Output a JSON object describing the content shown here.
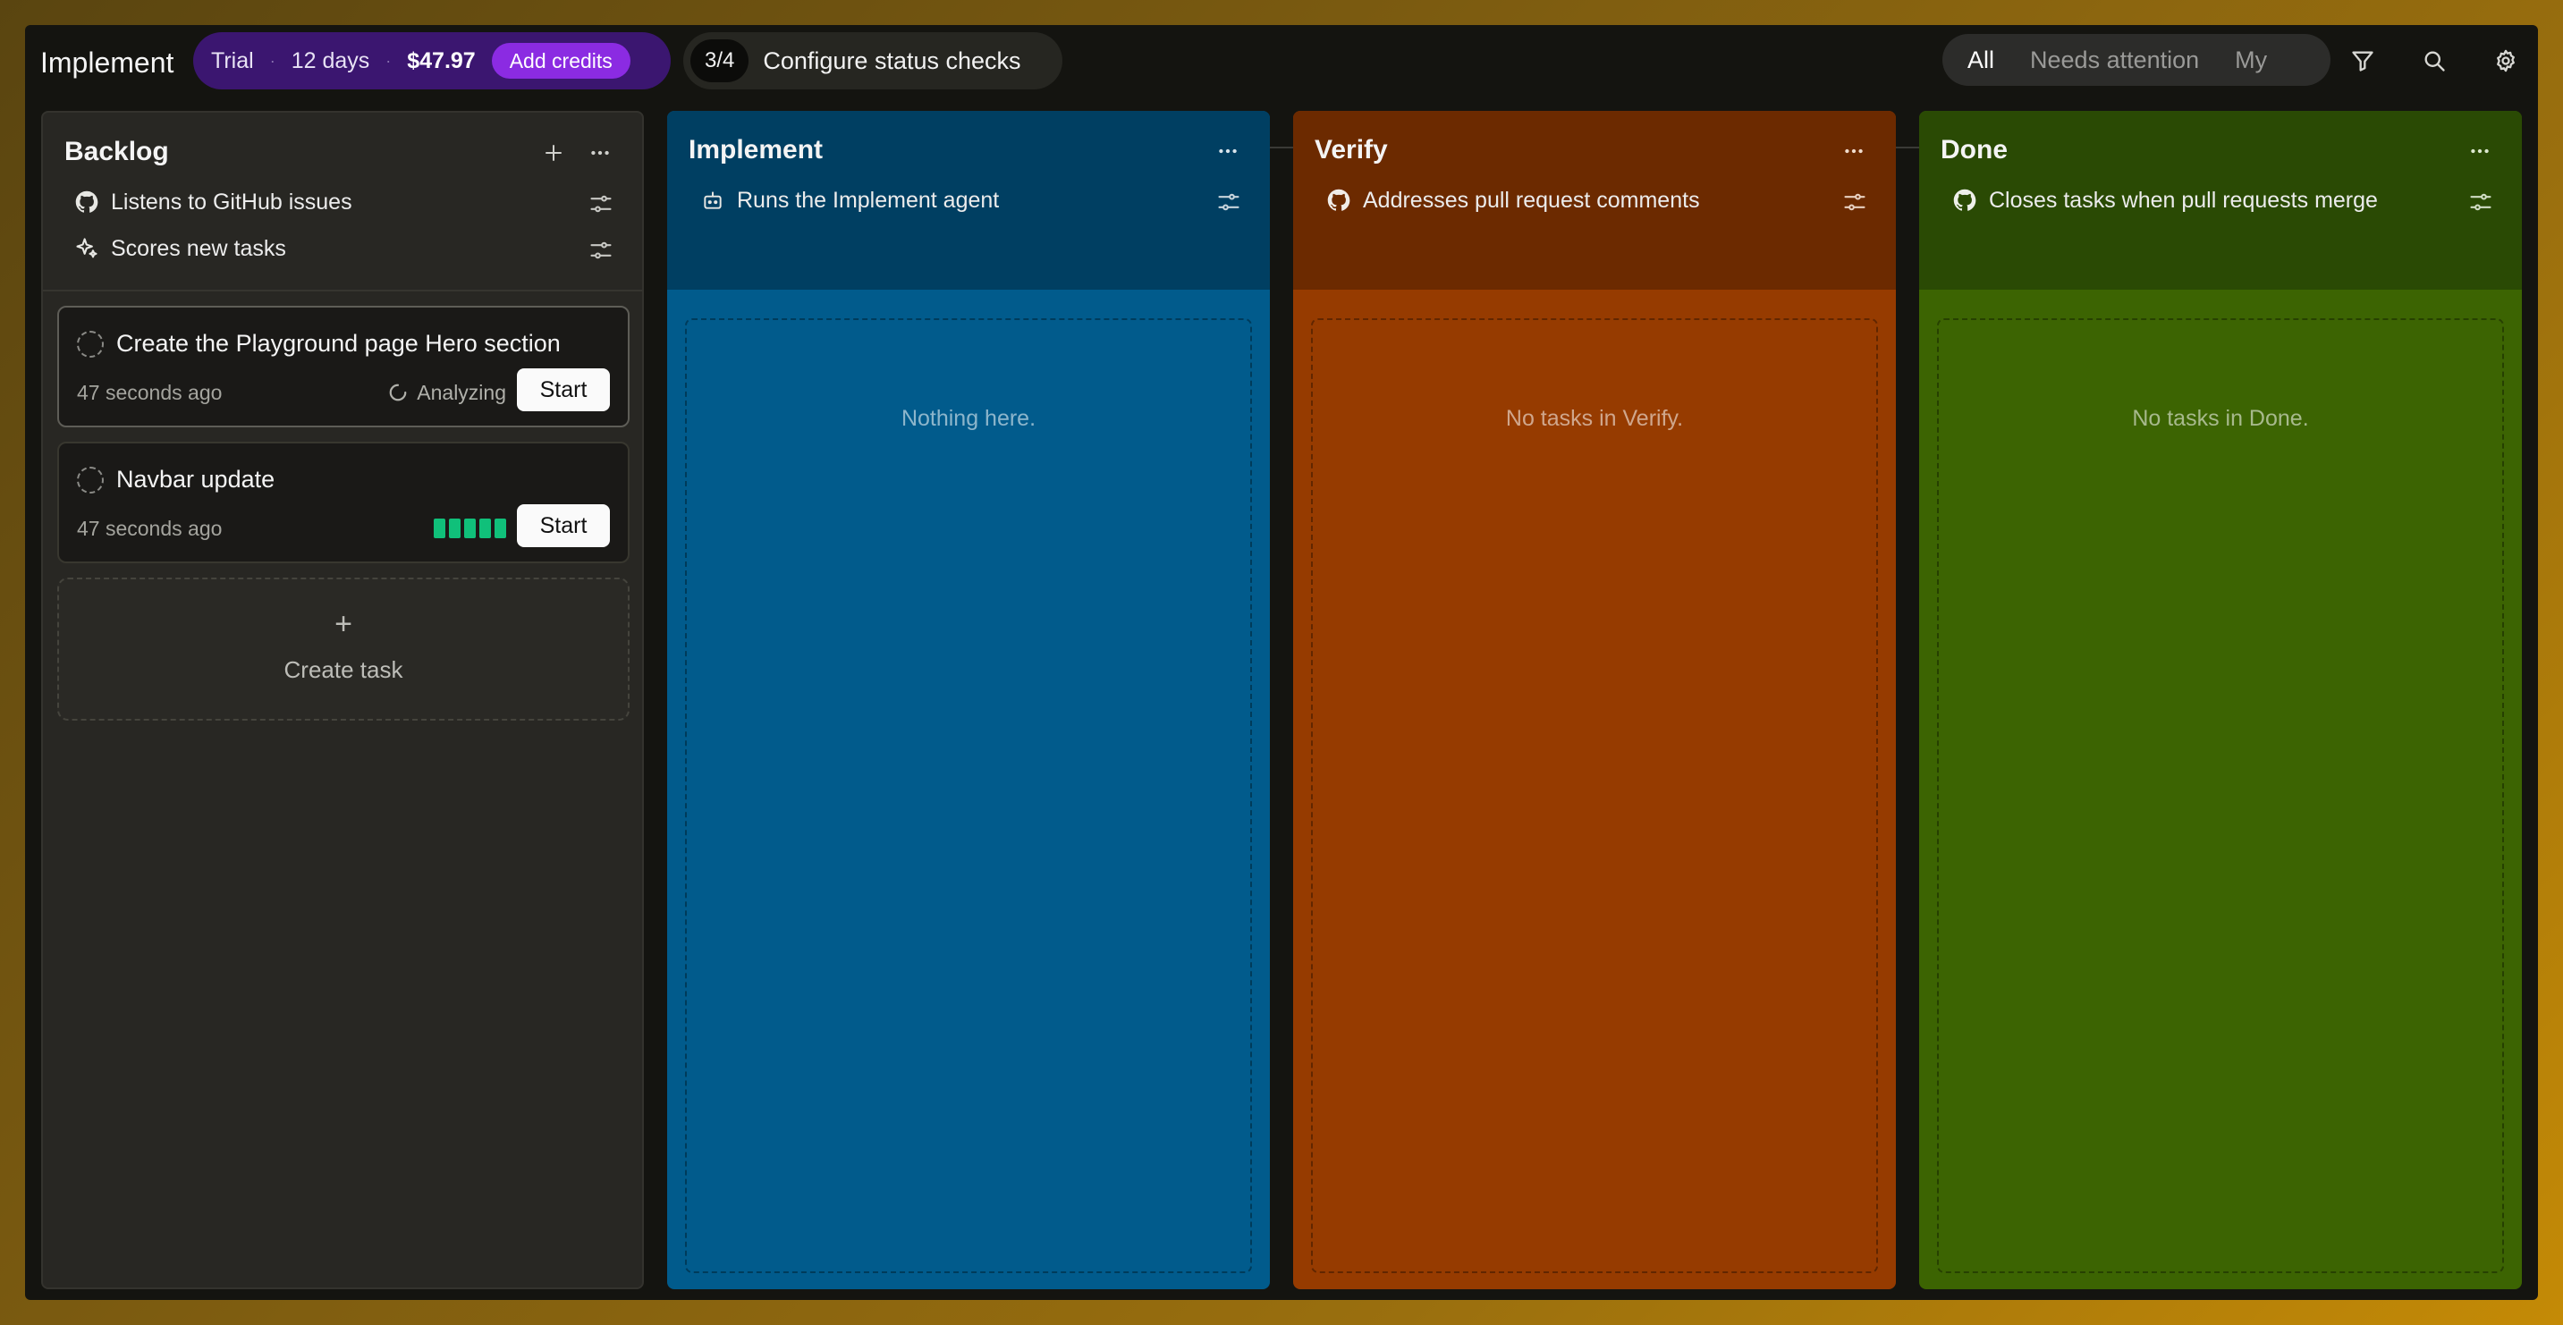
{
  "header": {
    "title": "Implement",
    "trial": {
      "label": "Trial",
      "days": "12 days",
      "amount": "$47.97",
      "add_credits": "Add credits"
    },
    "status_checks": {
      "count": "3/4",
      "label": "Configure status checks"
    },
    "filters": [
      {
        "label": "All",
        "active": true
      },
      {
        "label": "Needs attention",
        "active": false
      },
      {
        "label": "My",
        "active": false
      }
    ],
    "icons": [
      "filter-icon",
      "search-icon",
      "gear-icon"
    ]
  },
  "columns": {
    "backlog": {
      "title": "Backlog",
      "rules": [
        {
          "icon": "github-icon",
          "label": "Listens to GitHub issues"
        },
        {
          "icon": "sparkles-icon",
          "label": "Scores new tasks"
        }
      ],
      "tasks": [
        {
          "title": "Create the Playground page Hero section",
          "time": "47 seconds ago",
          "status": "Analyzing",
          "action": "Start"
        },
        {
          "title": "Navbar update",
          "time": "47 seconds ago",
          "score": 5,
          "action": "Start"
        }
      ],
      "create_task": {
        "plus": "+",
        "label": "Create task"
      }
    },
    "implement": {
      "title": "Implement",
      "rules": [
        {
          "icon": "bot-icon",
          "label": "Runs the Implement agent"
        }
      ],
      "empty": "Nothing here.",
      "color": "#015b8c"
    },
    "verify": {
      "title": "Verify",
      "rules": [
        {
          "icon": "github-icon",
          "label": "Addresses pull request comments"
        }
      ],
      "empty": "No tasks in Verify.",
      "color": "#963b00"
    },
    "done": {
      "title": "Done",
      "rules": [
        {
          "icon": "github-icon",
          "label": "Closes tasks when pull requests merge"
        }
      ],
      "empty": "No tasks in Done.",
      "color": "#3c6402"
    }
  }
}
